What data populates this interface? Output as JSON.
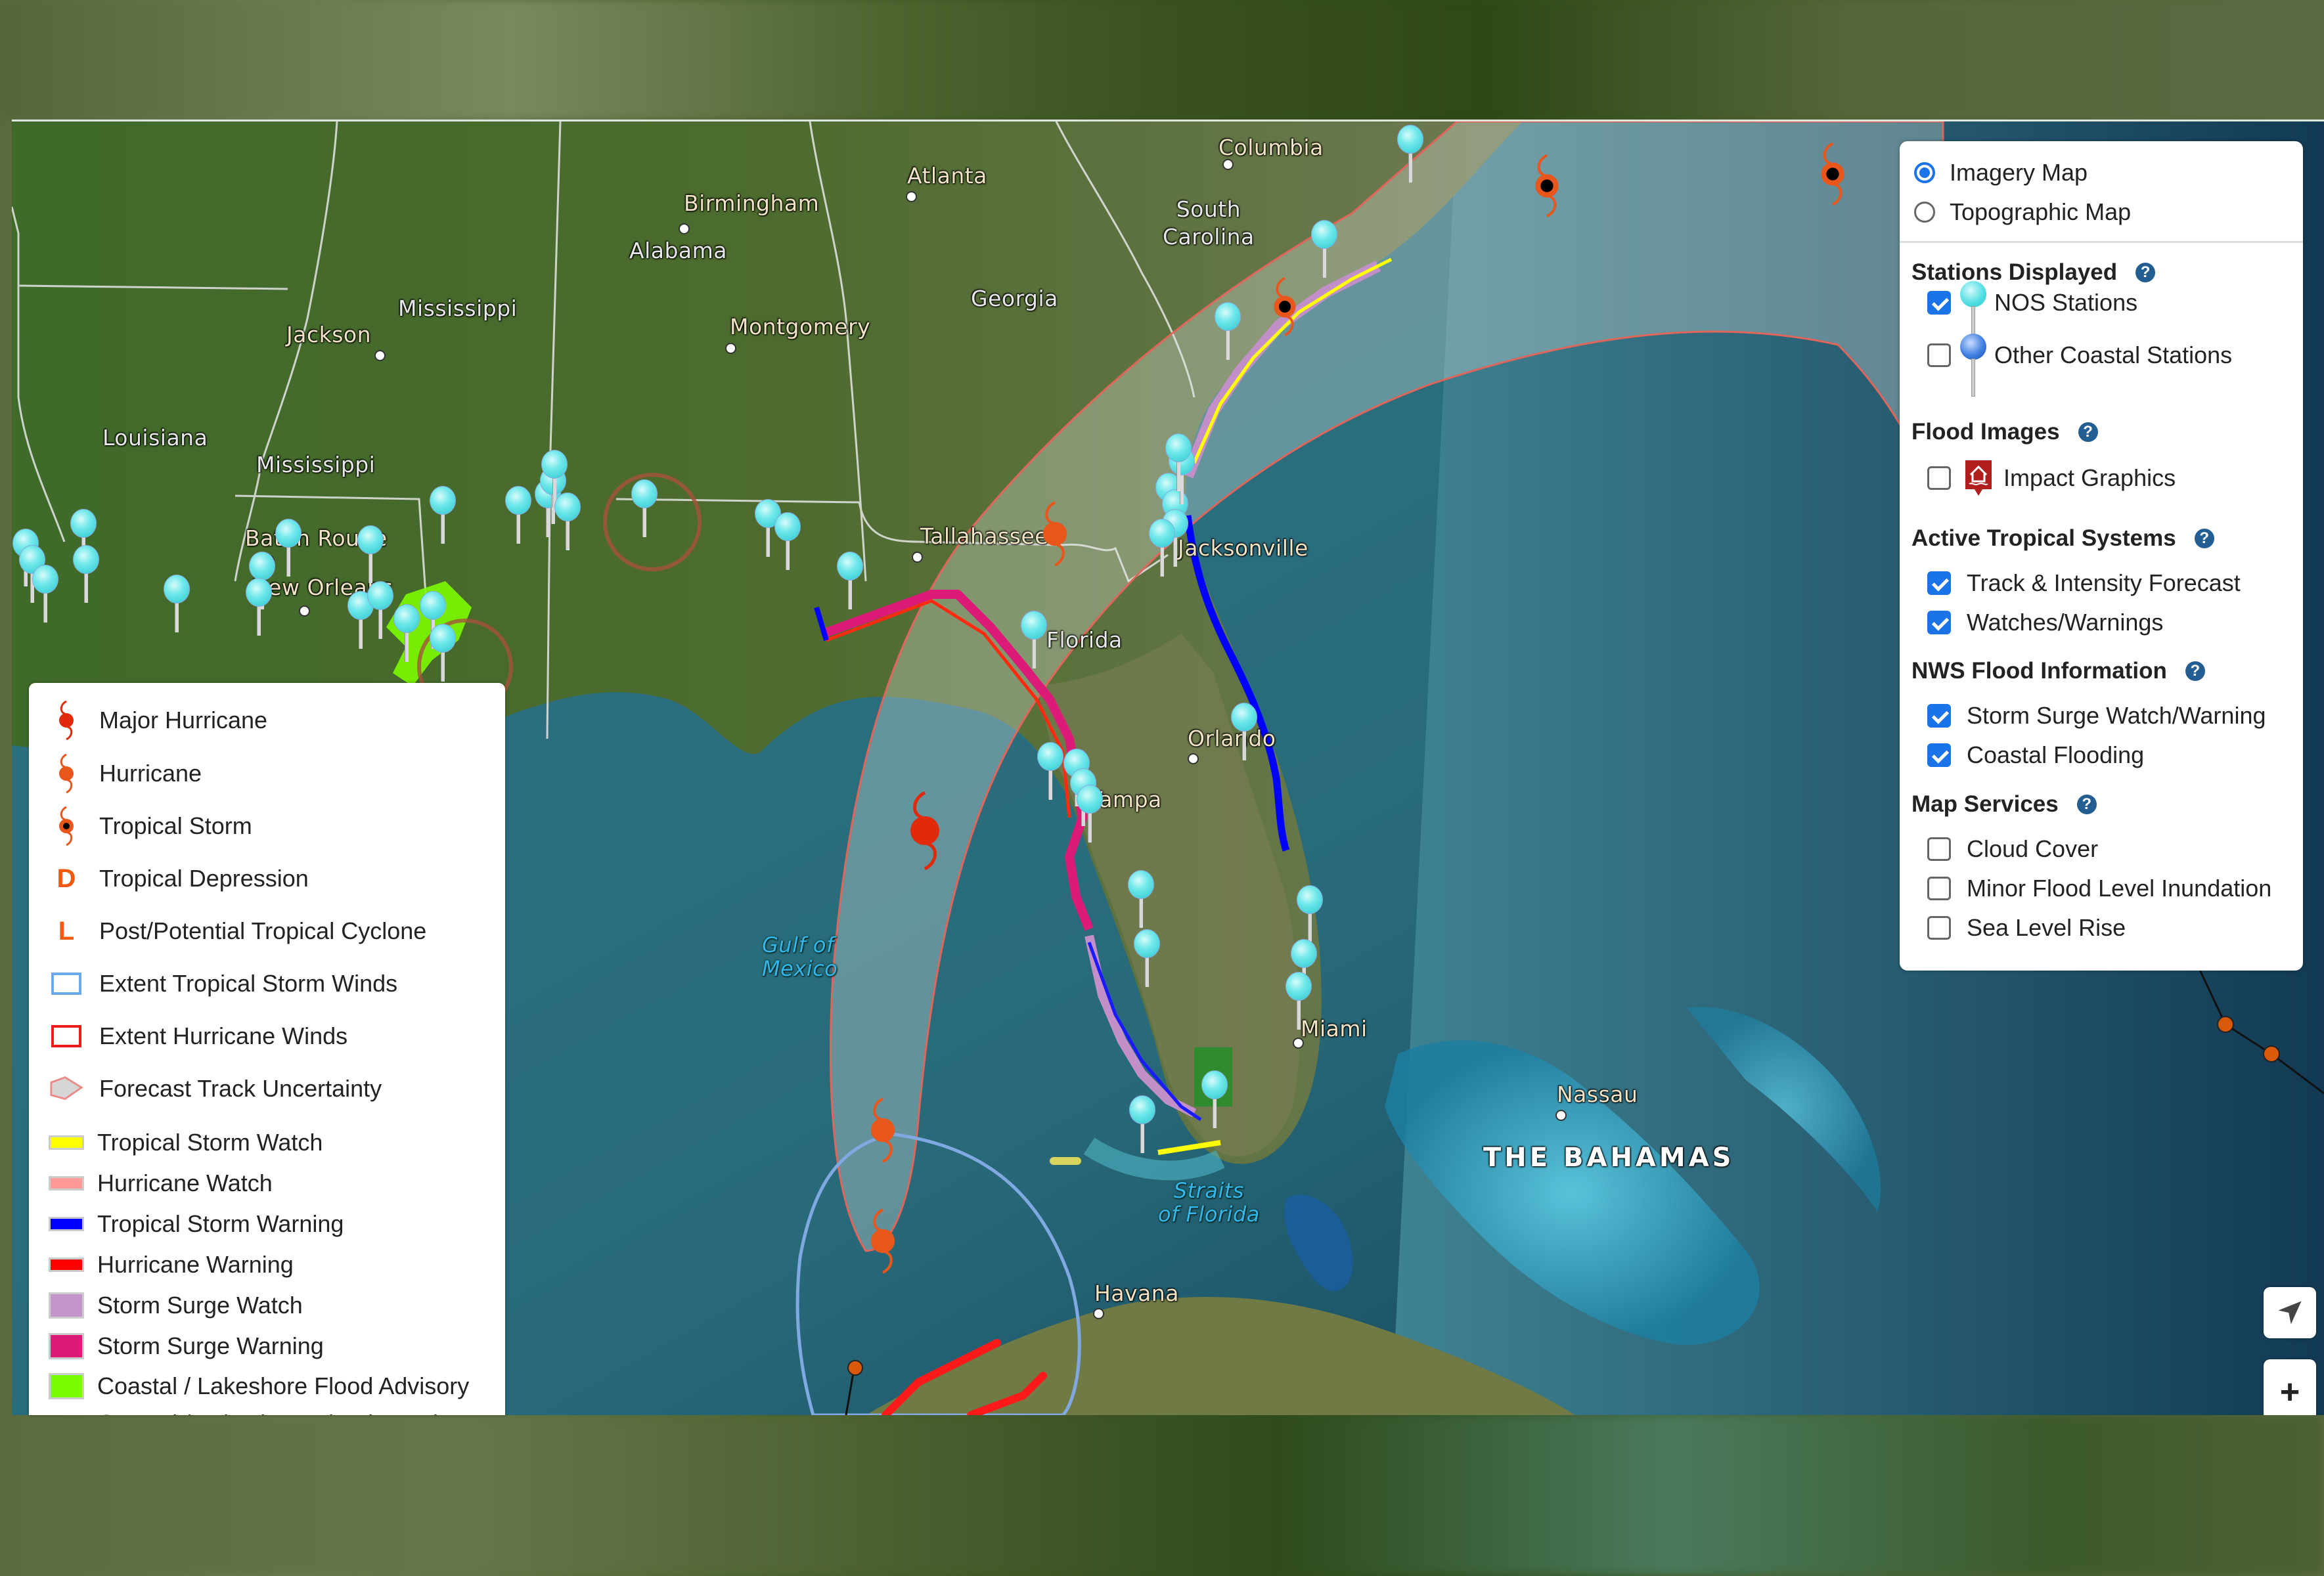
{
  "map": {
    "basemap": "Imagery Map",
    "places": {
      "states": [
        "Alabama",
        "Mississippi",
        "Louisiana",
        "Mississippi",
        "Georgia",
        "South Carolina",
        "Florida"
      ],
      "cities": [
        "Birmingham",
        "Atlanta",
        "Columbia",
        "Jackson",
        "Montgomery",
        "Baton Rouge",
        "New Orleans",
        "Tallahassee",
        "Jacksonville",
        "Tampa",
        "Orlando",
        "Miami",
        "Nassau",
        "Havana"
      ],
      "water": [
        "Gulf of Mexico",
        "Straits of Florida"
      ],
      "countries": [
        "THE BAHAMAS"
      ]
    },
    "labels": {
      "birmingham": "Birmingham",
      "atlanta": "Atlanta",
      "columbia": "Columbia",
      "south_carolina": "South\nCarolina",
      "alabama": "Alabama",
      "mississippi_state": "Mississippi",
      "jackson": "Jackson",
      "georgia": "Georgia",
      "montgomery": "Montgomery",
      "louisiana": "Louisiana",
      "mississippi_river": "Mississippi",
      "baton_rouge": "Baton Rouge",
      "new_orleans": "New Orleans",
      "tallahassee": "Tallahassee",
      "jacksonville": "Jacksonville",
      "florida": "Florida",
      "orlando": "Orlando",
      "tampa": "Tampa",
      "miami": "Miami",
      "gulf_1": "Gulf of",
      "gulf_2": "Mexico",
      "nassau": "Nassau",
      "bahamas": "THE BAHAMAS",
      "straits_1": "Straits",
      "straits_2": "of Florida",
      "havana": "Havana"
    },
    "colors": {
      "nos_station": "#52dfe4",
      "storm_orange": "#e8561c",
      "major_hurricane": "#e02a0a",
      "tropical_storm_warning": "#0000ff",
      "hurricane_warning": "#ff0000",
      "storm_surge_watch": "#c28fc8",
      "storm_surge_warning": "#dc1b78",
      "tropical_storm_watch": "#ffff00",
      "flood_advisory": "#7cfc00",
      "uncertainty_cone": "rgba(200,205,205,0.35)",
      "ts_wind_extent": "#7fa9e0"
    }
  },
  "legend": {
    "items": [
      {
        "symbol": "major-hurricane",
        "label": "Major Hurricane"
      },
      {
        "symbol": "hurricane",
        "label": "Hurricane"
      },
      {
        "symbol": "tropical-storm",
        "label": "Tropical Storm"
      },
      {
        "symbol": "tropical-depression",
        "glyph": "D",
        "label": "Tropical Depression"
      },
      {
        "symbol": "post-tropical",
        "glyph": "L",
        "label": "Post/Potential Tropical Cyclone"
      },
      {
        "symbol": "ts-winds-extent",
        "label": "Extent Tropical Storm Winds"
      },
      {
        "symbol": "hurricane-winds-extent",
        "label": "Extent Hurricane Winds"
      },
      {
        "symbol": "track-uncertainty",
        "label": "Forecast Track Uncertainty"
      },
      {
        "symbol": "swatch",
        "color": "#ffff00",
        "label": "Tropical Storm Watch"
      },
      {
        "symbol": "swatch",
        "color": "#ff9a98",
        "label": "Hurricane Watch"
      },
      {
        "symbol": "swatch",
        "color": "#0000ff",
        "label": "Tropical Storm Warning"
      },
      {
        "symbol": "swatch",
        "color": "#ff0000",
        "label": "Hurricane Warning"
      },
      {
        "symbol": "square",
        "color": "#c495c8",
        "label": "Storm Surge Watch"
      },
      {
        "symbol": "square",
        "color": "#dc1b78",
        "label": "Storm Surge Warning"
      },
      {
        "symbol": "square",
        "color": "#7cfc00",
        "label": "Coastal / Lakeshore Flood Advisory"
      },
      {
        "symbol": "truncated",
        "label": "Coastal / Lakeshore Flood Watch"
      }
    ]
  },
  "panel": {
    "basemaps": [
      {
        "label": "Imagery Map",
        "selected": true
      },
      {
        "label": "Topographic Map",
        "selected": false
      }
    ],
    "sections": {
      "stations": {
        "title": "Stations Displayed",
        "items": [
          {
            "label": "NOS Stations",
            "checked": true,
            "icon_color": "#52dfe4"
          },
          {
            "label": "Other Coastal Stations",
            "checked": false,
            "icon_color": "#2d6fd6"
          }
        ]
      },
      "flood_images": {
        "title": "Flood Images",
        "items": [
          {
            "label": "Impact Graphics",
            "checked": false
          }
        ]
      },
      "tropical": {
        "title": "Active Tropical Systems",
        "items": [
          {
            "label": "Track & Intensity Forecast",
            "checked": true
          },
          {
            "label": "Watches/Warnings",
            "checked": true
          }
        ]
      },
      "nws_flood": {
        "title": "NWS Flood Information",
        "items": [
          {
            "label": "Storm Surge Watch/Warning",
            "checked": true
          },
          {
            "label": "Coastal Flooding",
            "checked": true
          }
        ]
      },
      "map_services": {
        "title": "Map Services",
        "items": [
          {
            "label": "Cloud Cover",
            "checked": false
          },
          {
            "label": "Minor Flood Level Inundation",
            "checked": false
          },
          {
            "label": "Sea Level Rise",
            "checked": false
          }
        ]
      }
    },
    "help_glyph": "?"
  },
  "controls": {
    "locate_icon": "navigation-arrow",
    "zoom_in_label": "+"
  }
}
